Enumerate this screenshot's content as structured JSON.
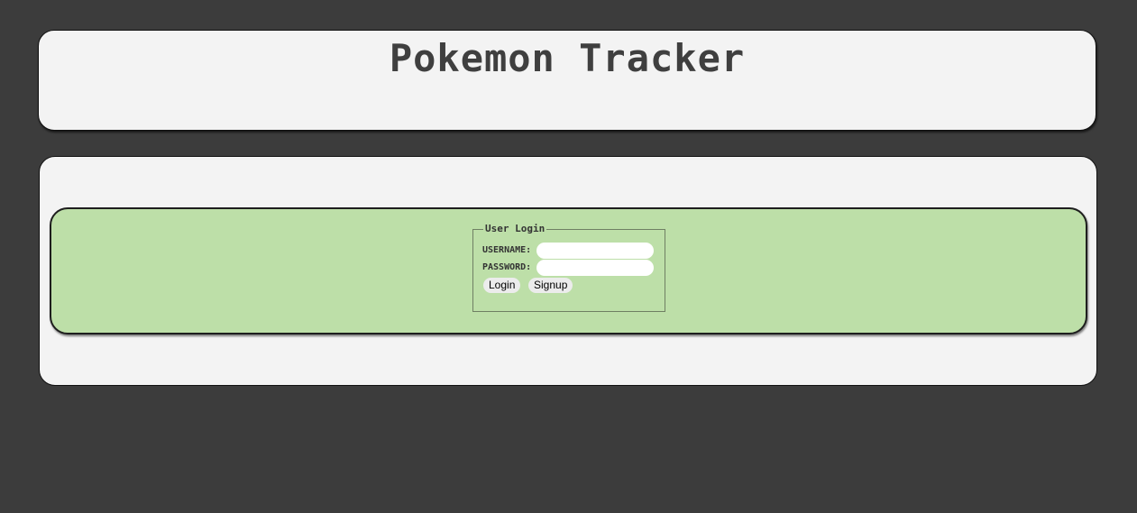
{
  "header": {
    "title": "Pokemon Tracker"
  },
  "login": {
    "legend": "User Login",
    "username_label": "USERNAME:",
    "username_value": "",
    "password_label": "PASSWORD:",
    "password_value": "",
    "login_button": "Login",
    "signup_button": "Signup"
  },
  "colors": {
    "page_background": "#3c3c3c",
    "panel_background": "#f3f3f3",
    "login_band": "#bddfa8",
    "title_text": "#3f3f3f"
  }
}
